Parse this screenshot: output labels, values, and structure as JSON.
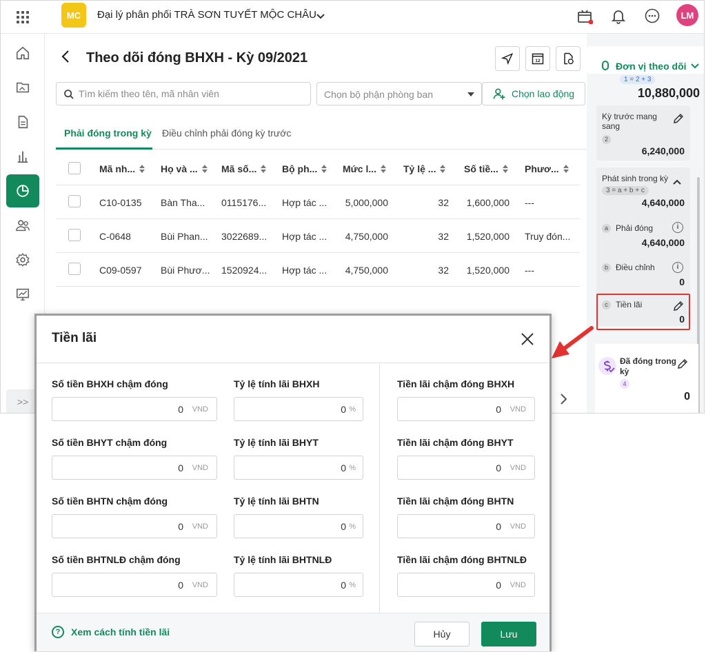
{
  "topbar": {
    "logo_text": "MC",
    "company_name": "Đại lý phân phối TRÀ SƠN TUYẾT MỘC CHÂU",
    "avatar_initials": "LM",
    "avatar_color": "#e0427f",
    "logo_color": "#f2c715",
    "notification_dot_color": "#e3322f"
  },
  "sidebar": {
    "accent_color": "#138a5b",
    "items": [
      {
        "icon": "home-icon"
      },
      {
        "icon": "folder-image-icon"
      },
      {
        "icon": "document-icon"
      },
      {
        "icon": "bar-chart-icon"
      },
      {
        "icon": "pie-chart-icon",
        "active": true
      },
      {
        "icon": "people-icon"
      },
      {
        "icon": "gear-icon"
      },
      {
        "icon": "monitor-chart-icon"
      }
    ],
    "expand_label": ">>"
  },
  "page": {
    "title": "Theo dõi đóng BHXH - Kỳ 09/2021",
    "search_placeholder": "Tìm kiếm theo tên, mã nhân viên",
    "dept_placeholder": "Chọn bộ phận phòng ban",
    "choose_employee_label": "Chọn lao động",
    "tabs": [
      {
        "label": "Phải đóng trong kỳ",
        "active": true
      },
      {
        "label": "Điều chỉnh phải đóng kỳ trước",
        "active": false
      }
    ]
  },
  "table": {
    "headers": [
      "Mã nh...",
      "Họ và ...",
      "Mã số...",
      "Bộ ph...",
      "Mức l...",
      "Tỷ lệ ...",
      "Số tiề...",
      "Phươ..."
    ],
    "rows": [
      [
        "C10-0135",
        "Bàn Tha...",
        "0115176...",
        "Hợp tác ...",
        "5,000,000",
        "32",
        "1,600,000",
        "---"
      ],
      [
        "C-0648",
        "Bùi Phan...",
        "3022689...",
        "Hợp tác ...",
        "4,750,000",
        "32",
        "1,520,000",
        "Truy đón..."
      ],
      [
        "C09-0597",
        "Bùi Phươ...",
        "1520924...",
        "Hợp tác ...",
        "4,750,000",
        "32",
        "1,520,000",
        "---"
      ]
    ]
  },
  "right_panel": {
    "header_label": "Đơn vị theo dõi",
    "total_formula": "1 = 2 + 3",
    "total_value": "10,880,000",
    "prev_period": {
      "label": "Kỳ trước mang sang",
      "badge": "2",
      "value": "6,240,000"
    },
    "incurred": {
      "label": "Phát sinh trong kỳ",
      "formula": "3 = a + b + c",
      "value": "4,640,000"
    },
    "payable": {
      "badge": "a",
      "label": "Phải đóng",
      "value": "4,640,000"
    },
    "adjustment": {
      "badge": "b",
      "label": "Điều chỉnh",
      "value": "0"
    },
    "interest": {
      "badge": "c",
      "label": "Tiền lãi",
      "value": "0"
    },
    "paid": {
      "label": "Đã đóng trong kỳ",
      "badge": "4",
      "value": "0"
    }
  },
  "modal": {
    "title": "Tiền lãi",
    "currency_unit": "VND",
    "percent_unit": "%",
    "rows": [
      {
        "amount_label": "Số tiền BHXH chậm đóng",
        "amount_value": "0",
        "rate_label": "Tỷ lệ tính lãi BHXH",
        "rate_value": "0",
        "interest_label": "Tiền lãi chậm đóng BHXH",
        "interest_value": "0"
      },
      {
        "amount_label": "Số tiền BHYT chậm đóng",
        "amount_value": "0",
        "rate_label": "Tỷ lệ tính lãi BHYT",
        "rate_value": "0",
        "interest_label": "Tiền lãi chậm đóng BHYT",
        "interest_value": "0"
      },
      {
        "amount_label": "Số tiền BHTN chậm đóng",
        "amount_value": "0",
        "rate_label": "Tỷ lệ tính lãi BHTN",
        "rate_value": "0",
        "interest_label": "Tiền lãi chậm đóng BHTN",
        "interest_value": "0"
      },
      {
        "amount_label": "Số tiền BHTNLĐ chậm đóng",
        "amount_value": "0",
        "rate_label": "Tỷ lệ tính lãi BHTNLĐ",
        "rate_value": "0",
        "interest_label": "Tiền lãi chậm đóng BHTNLĐ",
        "interest_value": "0"
      }
    ],
    "help_link": "Xem cách tính tiền lãi",
    "cancel_label": "Hủy",
    "save_label": "Lưu"
  }
}
